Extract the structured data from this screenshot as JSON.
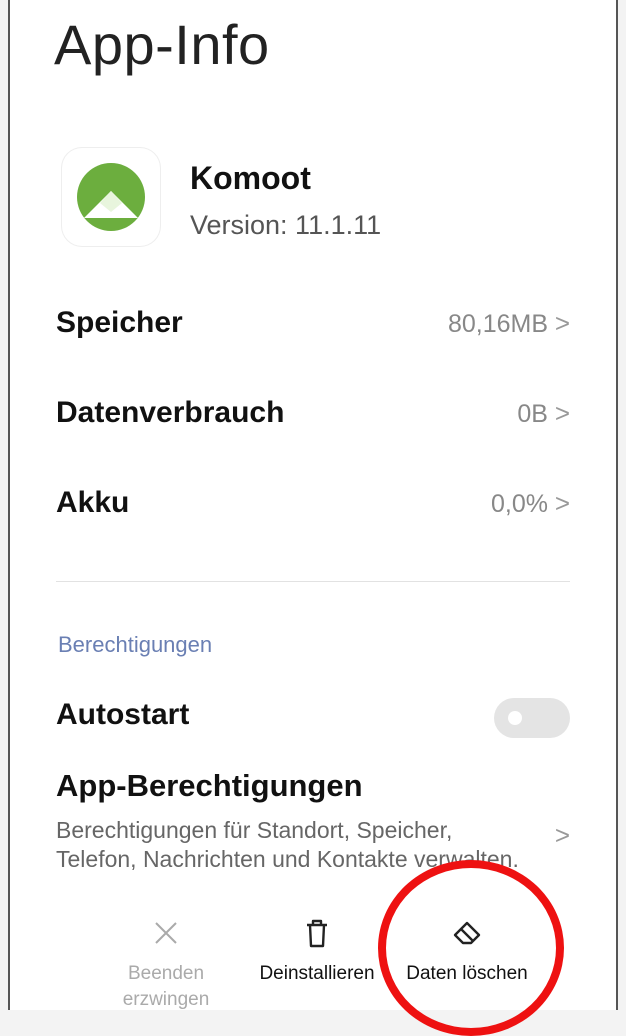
{
  "page_title": "App-Info",
  "app": {
    "name": "Komoot",
    "version": "Version: 11.1.11",
    "icon": "komoot-logo"
  },
  "rows": [
    {
      "label": "Speicher",
      "value": "80,16MB"
    },
    {
      "label": "Datenverbrauch",
      "value": "0B"
    },
    {
      "label": "Akku",
      "value": "0,0%"
    }
  ],
  "chevron": ">",
  "section": {
    "label": "Berechtigungen"
  },
  "autostart": {
    "label": "Autostart",
    "enabled": false
  },
  "permissions": {
    "title": "App-Berechtigungen",
    "description": "Berechtigungen für Standort, Speicher, Telefon, Nachrichten und Kontakte verwalten."
  },
  "bottom_bar": {
    "force_stop": {
      "label": "Beenden erzwingen",
      "icon": "close-icon"
    },
    "uninstall": {
      "label": "Deinstallieren",
      "icon": "trash-icon"
    },
    "clear_data": {
      "label": "Daten löschen",
      "icon": "eraser-icon"
    }
  },
  "colors": {
    "annotation_circle": "#ee1111",
    "section_label": "#6a7fb3",
    "komoot_green": "#6cae3e"
  }
}
